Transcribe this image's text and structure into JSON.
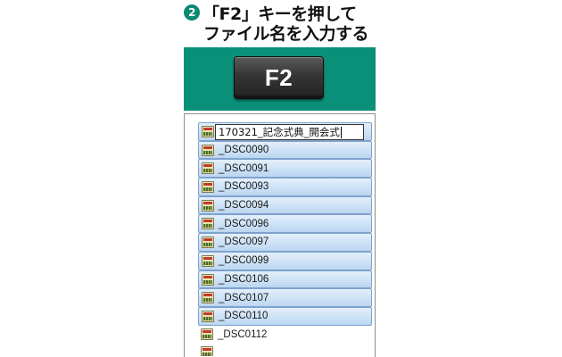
{
  "caption": {
    "step_number": "2",
    "line1": "「F2」キーを押して",
    "line2": "ファイル名を入力する"
  },
  "key": {
    "label": "F2"
  },
  "colors": {
    "banner": "#0a8f78",
    "selection": "#cde2f6",
    "selection_border": "#7da2ce"
  },
  "file_list": {
    "rename_value": "170321_記念式典_開会式",
    "files": [
      "_DSC0090",
      "_DSC0091",
      "_DSC0093",
      "_DSC0094",
      "_DSC0096",
      "_DSC0097",
      "_DSC0099",
      "_DSC0106",
      "_DSC0107",
      "_DSC0110",
      "_DSC0112"
    ],
    "icon": "jpg-file-icon"
  }
}
